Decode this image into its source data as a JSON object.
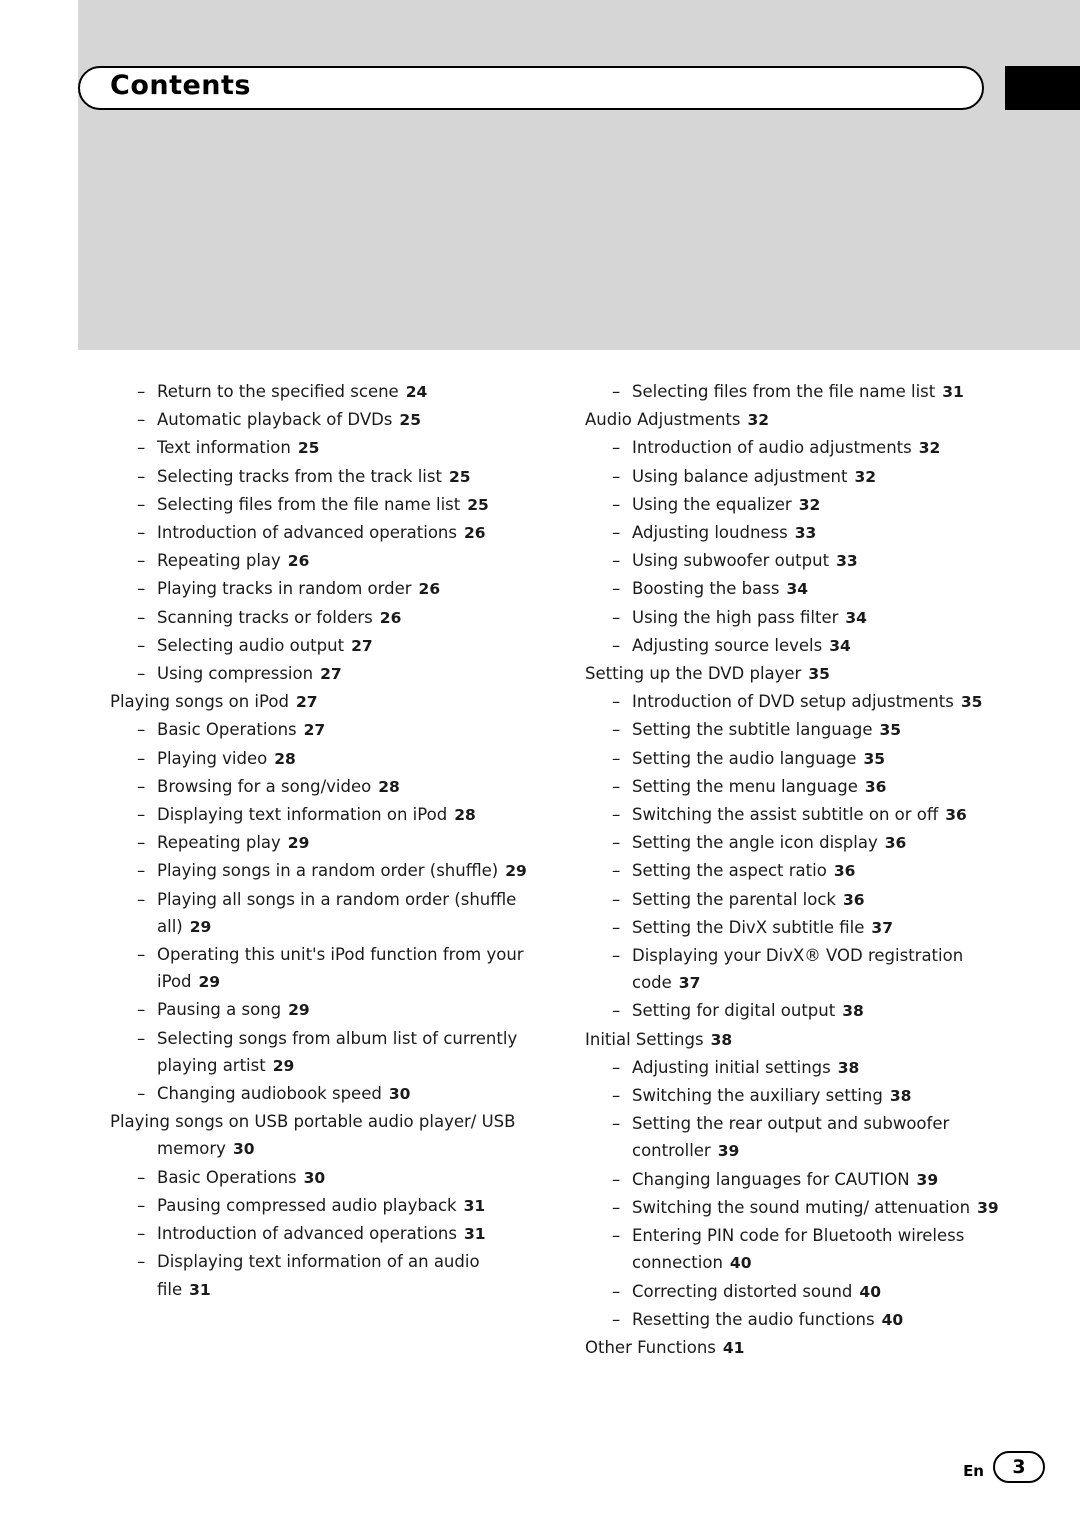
{
  "header": {
    "title": "Contents"
  },
  "footer": {
    "lang": "En",
    "page": "3"
  },
  "left_column": [
    {
      "level": 2,
      "text": "Return to the specified scene",
      "page": "24"
    },
    {
      "level": 2,
      "text": "Automatic playback of DVDs",
      "page": "25"
    },
    {
      "level": 2,
      "text": "Text information",
      "page": "25"
    },
    {
      "level": 2,
      "text": "Selecting tracks from the track list",
      "page": "25"
    },
    {
      "level": 2,
      "text": "Selecting files from the file name list",
      "page": "25"
    },
    {
      "level": 2,
      "text": "Introduction of advanced operations",
      "page": "26"
    },
    {
      "level": 2,
      "text": "Repeating play",
      "page": "26"
    },
    {
      "level": 2,
      "text": "Playing tracks in random order",
      "page": "26"
    },
    {
      "level": 2,
      "text": "Scanning tracks or folders",
      "page": "26"
    },
    {
      "level": 2,
      "text": "Selecting audio output",
      "page": "27"
    },
    {
      "level": 2,
      "text": "Using compression",
      "page": "27"
    },
    {
      "level": 1,
      "text": "Playing songs on iPod",
      "page": "27"
    },
    {
      "level": 2,
      "text": "Basic Operations",
      "page": "27"
    },
    {
      "level": 2,
      "text": "Playing video",
      "page": "28"
    },
    {
      "level": 2,
      "text": "Browsing for a song/video",
      "page": "28"
    },
    {
      "level": 2,
      "text": "Displaying text information on iPod",
      "page": "28"
    },
    {
      "level": 2,
      "text": "Repeating play",
      "page": "29"
    },
    {
      "level": 2,
      "text": "Playing songs in a random order (shuffle)",
      "page": "29"
    },
    {
      "level": 2,
      "text": "Playing all songs in a random order (shuffle all)",
      "page": "29"
    },
    {
      "level": 2,
      "text": "Operating this unit's iPod function from your iPod",
      "page": "29"
    },
    {
      "level": 2,
      "text": "Pausing a song",
      "page": "29"
    },
    {
      "level": 2,
      "text": "Selecting songs from album list of currently playing artist",
      "page": "29"
    },
    {
      "level": 2,
      "text": "Changing audiobook speed",
      "page": "30"
    },
    {
      "level": 1,
      "text": "Playing songs on USB portable audio player/ USB memory",
      "page": "30"
    },
    {
      "level": 2,
      "text": "Basic Operations",
      "page": "30"
    },
    {
      "level": 2,
      "text": "Pausing compressed audio playback",
      "page": "31"
    },
    {
      "level": 2,
      "text": "Introduction of advanced operations",
      "page": "31"
    },
    {
      "level": 2,
      "text": "Displaying text information of an audio file",
      "page": "31"
    }
  ],
  "right_column": [
    {
      "level": 2,
      "text": "Selecting files from the file name list",
      "page": "31"
    },
    {
      "level": 1,
      "text": "Audio Adjustments",
      "page": "32"
    },
    {
      "level": 2,
      "text": "Introduction of audio adjustments",
      "page": "32"
    },
    {
      "level": 2,
      "text": "Using balance adjustment",
      "page": "32"
    },
    {
      "level": 2,
      "text": "Using the equalizer",
      "page": "32"
    },
    {
      "level": 2,
      "text": "Adjusting loudness",
      "page": "33"
    },
    {
      "level": 2,
      "text": "Using subwoofer output",
      "page": "33"
    },
    {
      "level": 2,
      "text": "Boosting the bass",
      "page": "34"
    },
    {
      "level": 2,
      "text": "Using the high pass filter",
      "page": "34"
    },
    {
      "level": 2,
      "text": "Adjusting source levels",
      "page": "34"
    },
    {
      "level": 1,
      "text": "Setting up the DVD player",
      "page": "35"
    },
    {
      "level": 2,
      "text": "Introduction of DVD setup adjustments",
      "page": "35"
    },
    {
      "level": 2,
      "text": "Setting the subtitle language",
      "page": "35"
    },
    {
      "level": 2,
      "text": "Setting the audio language",
      "page": "35"
    },
    {
      "level": 2,
      "text": "Setting the menu language",
      "page": "36"
    },
    {
      "level": 2,
      "text": "Switching the assist subtitle on or off",
      "page": "36"
    },
    {
      "level": 2,
      "text": "Setting the angle icon display",
      "page": "36"
    },
    {
      "level": 2,
      "text": "Setting the aspect ratio",
      "page": "36"
    },
    {
      "level": 2,
      "text": "Setting the parental lock",
      "page": "36"
    },
    {
      "level": 2,
      "text": "Setting the DivX subtitle file",
      "page": "37"
    },
    {
      "level": 2,
      "text": "Displaying your DivX® VOD registration code",
      "page": "37"
    },
    {
      "level": 2,
      "text": "Setting for digital output",
      "page": "38"
    },
    {
      "level": 1,
      "text": "Initial Settings",
      "page": "38"
    },
    {
      "level": 2,
      "text": "Adjusting initial settings",
      "page": "38"
    },
    {
      "level": 2,
      "text": "Switching the auxiliary setting",
      "page": "38"
    },
    {
      "level": 2,
      "text": "Setting the rear output and subwoofer controller",
      "page": "39"
    },
    {
      "level": 2,
      "text": "Changing languages for CAUTION",
      "page": "39"
    },
    {
      "level": 2,
      "text": "Switching the sound muting/ attenuation",
      "page": "39"
    },
    {
      "level": 2,
      "text": "Entering PIN code for Bluetooth wireless connection",
      "page": "40"
    },
    {
      "level": 2,
      "text": "Correcting distorted sound",
      "page": "40"
    },
    {
      "level": 2,
      "text": "Resetting the audio functions",
      "page": "40"
    },
    {
      "level": 1,
      "text": "Other Functions",
      "page": "41"
    }
  ]
}
